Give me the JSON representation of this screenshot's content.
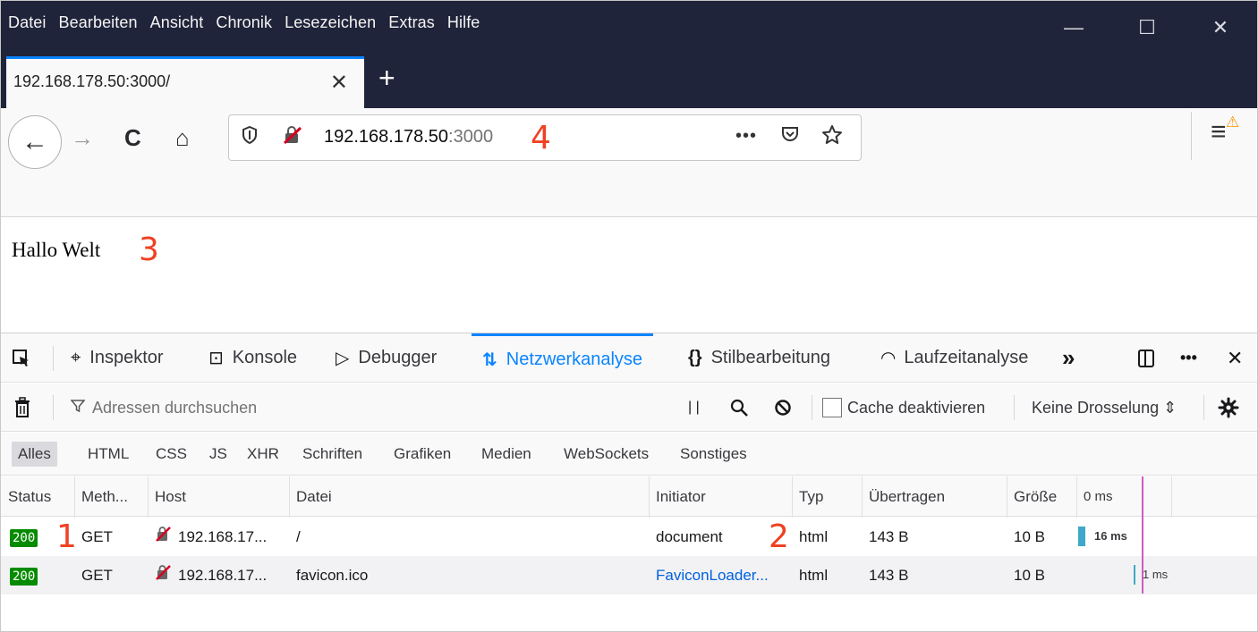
{
  "window": {
    "menu": [
      "Datei",
      "Bearbeiten",
      "Ansicht",
      "Chronik",
      "Lesezeichen",
      "Extras",
      "Hilfe"
    ],
    "controls": {
      "minimize": "—",
      "maximize": "☐",
      "close": "✕"
    }
  },
  "tab": {
    "title": "192.168.178.50:3000/",
    "close": "✕",
    "new_tab": "+"
  },
  "navbar": {
    "back": "←",
    "forward": "→",
    "reload": "C",
    "home": "⌂",
    "url_host": "192.168.178.50",
    "url_port": ":3000",
    "url_more": "•••",
    "menu_icon": "≡",
    "warning_icon": "⚠"
  },
  "annotations": {
    "a1": "1",
    "a2": "2",
    "a3": "3",
    "a4": "4"
  },
  "page": {
    "text": "Hallo Welt"
  },
  "devtools": {
    "tabs": [
      {
        "label": "Inspektor",
        "icon": "⌖"
      },
      {
        "label": "Konsole",
        "icon": "⊡"
      },
      {
        "label": "Debugger",
        "icon": "▷"
      },
      {
        "label": "Netzwerkanalyse",
        "icon": "⇅"
      },
      {
        "label": "Stilbearbeitung",
        "icon": "{}"
      },
      {
        "label": "Laufzeitanalyse",
        "icon": "◠"
      }
    ],
    "more_tabs": "»",
    "overflow": "•••",
    "close": "✕"
  },
  "network": {
    "filter_placeholder": "Adressen durchsuchen",
    "pause": "| |",
    "cache_label": "Cache deaktivieren",
    "throttle": "Keine Drosselung ⇕",
    "type_filters": [
      "Alles",
      "HTML",
      "CSS",
      "JS",
      "XHR",
      "Schriften",
      "Grafiken",
      "Medien",
      "WebSockets",
      "Sonstiges"
    ],
    "columns": [
      "Status",
      "Meth...",
      "Host",
      "Datei",
      "Initiator",
      "Typ",
      "Übertragen",
      "Größe",
      "0 ms"
    ],
    "rows": [
      {
        "status": "200",
        "method": "GET",
        "host": "192.168.17...",
        "file": "/",
        "initiator": "document",
        "type": "html",
        "transferred": "143 B",
        "size": "10 B",
        "timing": "16 ms"
      },
      {
        "status": "200",
        "method": "GET",
        "host": "192.168.17...",
        "file": "favicon.ico",
        "initiator": "FaviconLoader...",
        "type": "html",
        "transferred": "143 B",
        "size": "10 B",
        "timing": "1 ms"
      }
    ]
  },
  "colors": {
    "accent": "#0a84ff",
    "status_ok": "#058b00",
    "annotation": "#ef4123",
    "titlebar": "#20243a"
  }
}
